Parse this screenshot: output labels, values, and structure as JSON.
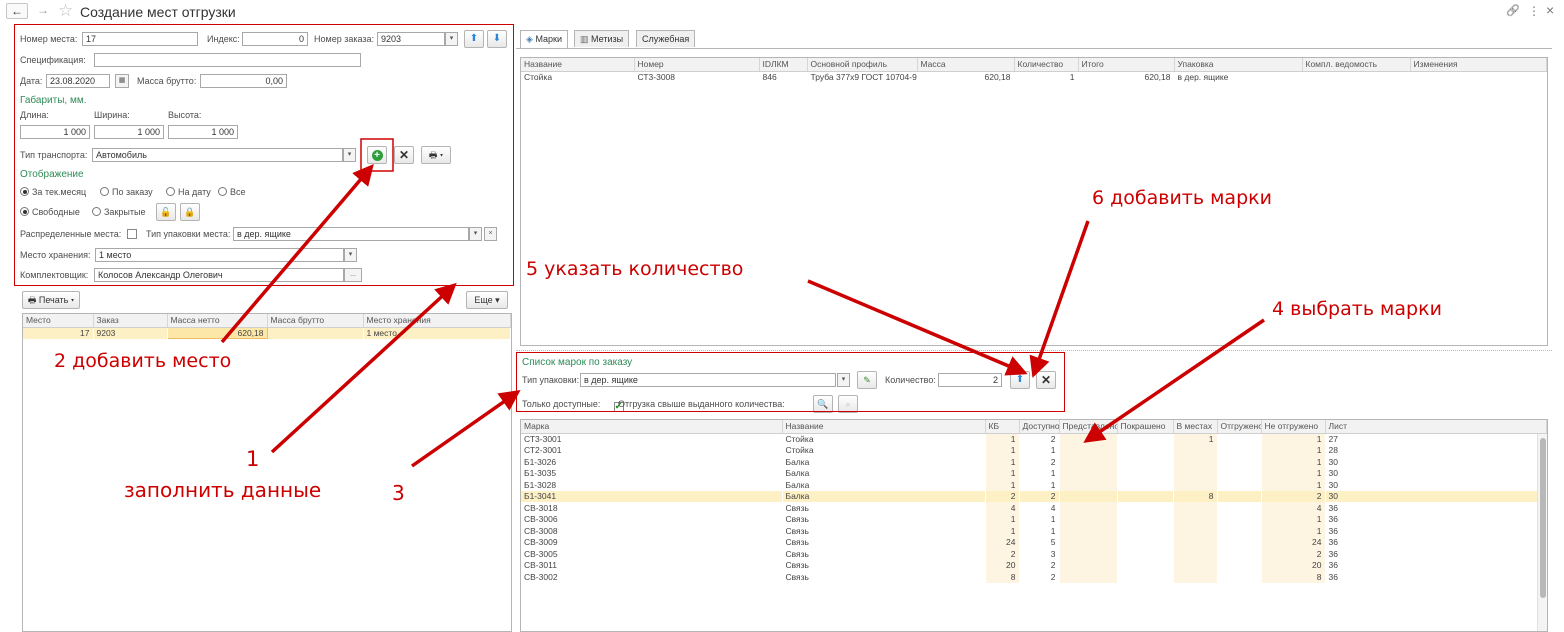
{
  "window": {
    "title": "Создание мест отгрузки",
    "back_icon": "←",
    "forward_icon": "→",
    "star_icon": "☆",
    "link_icon": "🔗",
    "menu_icon": "⋮",
    "close_icon": "×"
  },
  "form": {
    "place_label": "Номер места:",
    "place_value": "17",
    "index_label": "Индекс:",
    "index_value": "0",
    "order_label": "Номер заказа:",
    "order_value": "9203",
    "spec_label": "Спецификация:",
    "spec_value": "",
    "date_label": "Дата:",
    "date_value": "23.08.2020",
    "gross_label": "Масса брутто:",
    "gross_value": "0,00",
    "dims_title": "Габариты, мм.",
    "length_label": "Длина:",
    "length_value": "1 000",
    "width_label": "Ширина:",
    "width_value": "1 000",
    "height_label": "Высота:",
    "height_value": "1 000",
    "transport_label": "Тип транспорта:",
    "transport_value": "Автомобиль",
    "display_title": "Отображение",
    "radio_period": [
      "За тек.месяц",
      "По заказу",
      "На дату",
      "Все"
    ],
    "radio_status": [
      "Свободные",
      "Закрытые"
    ],
    "distributed_label": "Распределенные места:",
    "pack_type_label": "Тип упаковки места:",
    "pack_type_value": "в дер. ящике",
    "storage_label": "Место хранения:",
    "storage_value": "1 место",
    "picker_label": "Комплектовщик:",
    "picker_value": "Колосов Александр Олегович",
    "print_label": "Печать",
    "more_label": "Еще"
  },
  "left_table": {
    "columns": [
      "Место",
      "Заказ",
      "Масса нетто",
      "Масса брутто",
      "Место хранения"
    ],
    "rows": [
      {
        "place": "17",
        "order": "9203",
        "net": "620,18",
        "gross": "",
        "storage": "1 место"
      }
    ]
  },
  "tabs": [
    "Марки",
    "Метизы",
    "Служебная"
  ],
  "top_table": {
    "columns": [
      "Название",
      "Номер",
      "IDЛКМ",
      "Основной профиль",
      "Масса",
      "Количество",
      "Итого",
      "Упаковка",
      "Компл. ведомость",
      "Изменения"
    ],
    "rows": [
      {
        "name": "Стойка",
        "number": "СТ3-3008",
        "id": "846",
        "profile": "Труба 377х9 ГОСТ 10704-91",
        "mass": "620,18",
        "qty": "1",
        "total": "620,18",
        "pack": "в дер. ящике",
        "sheet": "",
        "changes": ""
      }
    ]
  },
  "marks_panel": {
    "title": "Список марок по заказу",
    "pack_label": "Тип упаковки:",
    "pack_value": "в дер. ящике",
    "qty_label": "Количество:",
    "qty_value": "2",
    "only_available_label": "Только доступные:",
    "over_issue_label": "Отгрузка свыше выданного количества:"
  },
  "marks_table": {
    "columns": [
      "Марка",
      "Название",
      "КБ",
      "Доступно",
      "Представлено",
      "Покрашено",
      "В местах",
      "Отгружено",
      "Не отгружено",
      "Лист"
    ],
    "rows": [
      {
        "mark": "СТ3-3001",
        "name": "Стойка",
        "kb": "1",
        "avail": "2",
        "pres": "",
        "paint": "",
        "inplaces": "1",
        "shipped": "",
        "notshipped": "1",
        "sheet": "27"
      },
      {
        "mark": "СТ2-3001",
        "name": "Стойка",
        "kb": "1",
        "avail": "1",
        "pres": "",
        "paint": "",
        "inplaces": "",
        "shipped": "",
        "notshipped": "1",
        "sheet": "28"
      },
      {
        "mark": "Б1-3026",
        "name": "Балка",
        "kb": "1",
        "avail": "2",
        "pres": "",
        "paint": "",
        "inplaces": "",
        "shipped": "",
        "notshipped": "1",
        "sheet": "30"
      },
      {
        "mark": "Б1-3035",
        "name": "Балка",
        "kb": "1",
        "avail": "1",
        "pres": "",
        "paint": "",
        "inplaces": "",
        "shipped": "",
        "notshipped": "1",
        "sheet": "30"
      },
      {
        "mark": "Б1-3028",
        "name": "Балка",
        "kb": "1",
        "avail": "1",
        "pres": "",
        "paint": "",
        "inplaces": "",
        "shipped": "",
        "notshipped": "1",
        "sheet": "30"
      },
      {
        "mark": "Б1-3041",
        "name": "Балка",
        "kb": "2",
        "avail": "2",
        "pres": "",
        "paint": "",
        "inplaces": "8",
        "shipped": "",
        "notshipped": "2",
        "sheet": "30"
      },
      {
        "mark": "СВ-3018",
        "name": "Связь",
        "kb": "4",
        "avail": "4",
        "pres": "",
        "paint": "",
        "inplaces": "",
        "shipped": "",
        "notshipped": "4",
        "sheet": "36"
      },
      {
        "mark": "СВ-3006",
        "name": "Связь",
        "kb": "1",
        "avail": "1",
        "pres": "",
        "paint": "",
        "inplaces": "",
        "shipped": "",
        "notshipped": "1",
        "sheet": "36"
      },
      {
        "mark": "СВ-3008",
        "name": "Связь",
        "kb": "1",
        "avail": "1",
        "pres": "",
        "paint": "",
        "inplaces": "",
        "shipped": "",
        "notshipped": "1",
        "sheet": "36"
      },
      {
        "mark": "СВ-3009",
        "name": "Связь",
        "kb": "24",
        "avail": "5",
        "pres": "",
        "paint": "",
        "inplaces": "",
        "shipped": "",
        "notshipped": "24",
        "sheet": "36"
      },
      {
        "mark": "СВ-3005",
        "name": "Связь",
        "kb": "2",
        "avail": "3",
        "pres": "",
        "paint": "",
        "inplaces": "",
        "shipped": "",
        "notshipped": "2",
        "sheet": "36"
      },
      {
        "mark": "СВ-3011",
        "name": "Связь",
        "kb": "20",
        "avail": "2",
        "pres": "",
        "paint": "",
        "inplaces": "",
        "shipped": "",
        "notshipped": "20",
        "sheet": "36"
      },
      {
        "mark": "СВ-3002",
        "name": "Связь",
        "kb": "8",
        "avail": "2",
        "pres": "",
        "paint": "",
        "inplaces": "",
        "shipped": "",
        "notshipped": "8",
        "sheet": "36"
      }
    ],
    "selected_row": 5
  },
  "annotations": {
    "a1_num": "1",
    "a1_text": "заполнить данные",
    "a2": "2 добавить место",
    "a3": "3",
    "a4": "4 выбрать марки",
    "a5": "5 указать количество",
    "a6": "6 добавить марки"
  },
  "colors": {
    "annotation": "#cc0000",
    "section_green": "#2e8b57",
    "highlight_row": "#fdf0c4",
    "column_tint": "#fdf5e1"
  }
}
